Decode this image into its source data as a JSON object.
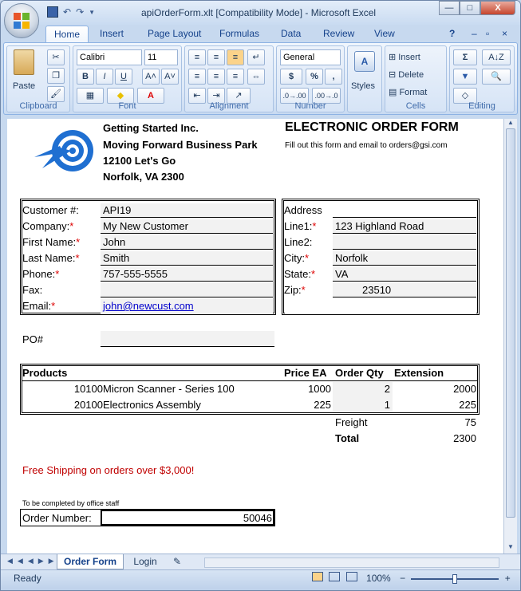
{
  "window": {
    "title": "apiOrderForm.xlt  [Compatibility Mode] - Microsoft Excel",
    "buttons": {
      "minimize": "—",
      "maximize": "□",
      "close": "X"
    },
    "qat": {
      "undo": "↶",
      "redo": "↷",
      "customize": "▼"
    }
  },
  "ribbon": {
    "tabs": [
      "Home",
      "Insert",
      "Page Layout",
      "Formulas",
      "Data",
      "Review",
      "View"
    ],
    "groups": {
      "clipboard": "Clipboard",
      "font": "Font",
      "alignment": "Alignment",
      "number": "Number",
      "styles": "Styles",
      "cells": "Cells",
      "editing": "Editing"
    },
    "paste_label": "Paste",
    "font_name": "Calibri",
    "font_size": "11",
    "number_format": "General",
    "styles_label": "Styles",
    "insert_label": "Insert",
    "delete_label": "Delete",
    "format_label": "Format",
    "font_buttons": {
      "bold": "B",
      "italic": "I",
      "underline": "U",
      "grow": "A˄",
      "shrink": "A˅",
      "fill": "◆",
      "color": "A"
    },
    "number_buttons": {
      "currency": "$",
      "percent": "%",
      "comma": ",",
      "inc_decimal": ".0→.00",
      "dec_decimal": ".00→.0"
    },
    "editing_buttons": {
      "sum": "Σ",
      "sort": "A↓Z",
      "fill": "▼",
      "clear": "◇"
    }
  },
  "sheet": {
    "company": {
      "name": "Getting Started Inc.",
      "address1": "Moving Forward Business Park",
      "address2": "12100 Let's Go",
      "city": "Norfolk, VA 2300"
    },
    "form_title": "ELECTRONIC ORDER FORM",
    "instructions": "Fill out this form and email to orders@gsi.com",
    "customer": {
      "customer_no_label": "Customer #:",
      "customer_no": "API19",
      "company_label": "Company:",
      "company": "My New Customer",
      "first_label": "First Name:",
      "first": "John",
      "last_label": "Last Name:",
      "last": "Smith",
      "phone_label": "Phone:",
      "phone": "757-555-5555",
      "fax_label": "Fax:",
      "fax": "",
      "email_label": "Email:",
      "email": "john@newcust.com"
    },
    "address": {
      "header": "Address",
      "line1_label": "Line1:",
      "line1": "123 Highland Road",
      "line2_label": "Line2:",
      "line2": "",
      "city_label": "City:",
      "city": "Norfolk",
      "state_label": "State:",
      "state": "VA",
      "zip_label": "Zip:",
      "zip": "23510"
    },
    "required_mark": "*",
    "po_label": "PO#",
    "po_value": "",
    "products": {
      "headers": [
        "Products",
        "Price EA",
        "Order Qty",
        "Extension"
      ],
      "rows": [
        {
          "id": "10100",
          "name": "Micron Scanner - Series 100",
          "price": "1000",
          "qty": "2",
          "ext": "2000"
        },
        {
          "id": "20100",
          "name": "Electronics Assembly",
          "price": "225",
          "qty": "1",
          "ext": "225"
        }
      ]
    },
    "freight_label": "Freight",
    "freight": "75",
    "total_label": "Total",
    "total": "2300",
    "shipping_note": "Free Shipping on orders over $3,000!",
    "office_note": "To be completed by office staff",
    "order_number_label": "Order Number:",
    "order_number": "50046"
  },
  "sheet_tabs": [
    "Order Form",
    "Login"
  ],
  "status": {
    "ready": "Ready",
    "zoom": "100%",
    "zoom_minus": "−",
    "zoom_plus": "+"
  },
  "colors": {
    "required": "#dd0000",
    "shipping_note": "#c00000",
    "link": "#0000cc"
  }
}
